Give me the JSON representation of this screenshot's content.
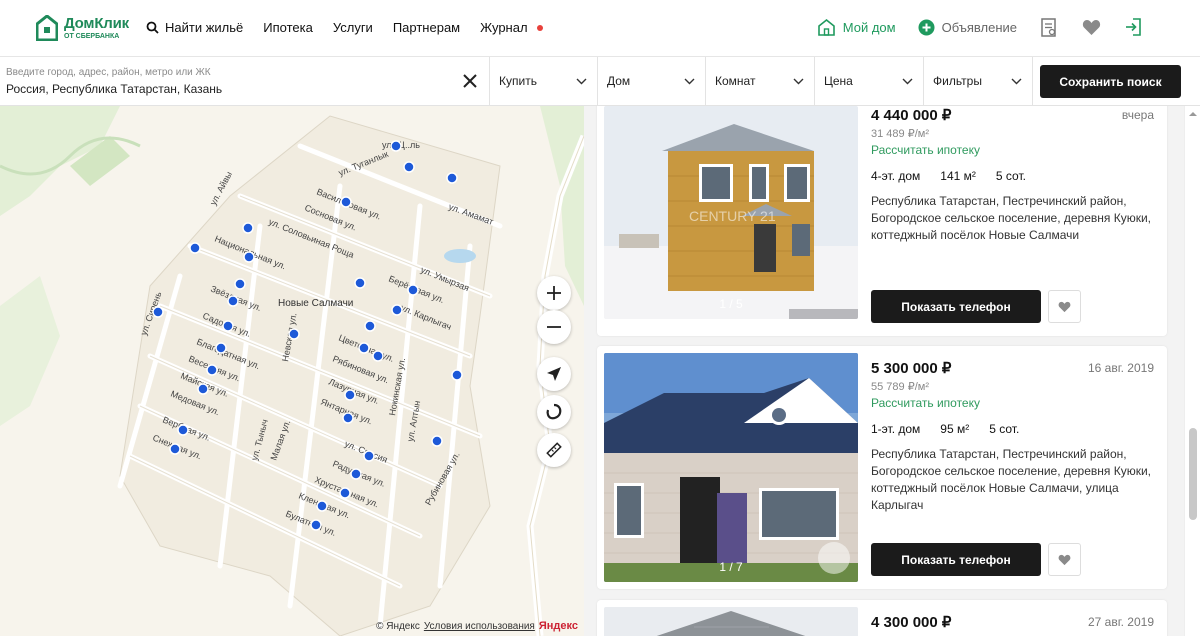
{
  "header": {
    "logo_name": "ДомКлик",
    "logo_sub": "ОТ СБЕРБАНКА",
    "nav": [
      {
        "label": "Найти жильё",
        "icon": "search-icon"
      },
      {
        "label": "Ипотека"
      },
      {
        "label": "Услуги"
      },
      {
        "label": "Партнерам"
      },
      {
        "label": "Журнал",
        "badge": "red-dot"
      }
    ],
    "my_home": "Мой дом",
    "announcement": "Объявление",
    "icons": [
      "document-icon",
      "heart-icon",
      "login-icon"
    ]
  },
  "filters": {
    "search_placeholder": "Введите город, адрес, район, метро или ЖК",
    "search_value": "Россия, Республика Татарстан, Казань",
    "deal": "Купить",
    "type": "Дом",
    "rooms": "Комнат",
    "price": "Цена",
    "more": "Фильтры",
    "save": "Сохранить поиск"
  },
  "map": {
    "village": "Новые Салмачи",
    "streets": [
      "ул. Щ..ль",
      "ул. Туганлык",
      "Васильковая ул.",
      "Сосновая ул.",
      "ул. Соловьиная Роща",
      "ул. Амамат",
      "ул. Айвы",
      "ул. Умырзая",
      "Национальная ул.",
      "Берёзовая ул.",
      "ул. Карлыгач",
      "Звёздная ул.",
      "Садовая ул.",
      "Благодатная ул.",
      "Весенняя ул.",
      "Майская ул.",
      "Медовая ул.",
      "Вербная ул.",
      "Снежная ул.",
      "ул. Сирень",
      "Невская ул.",
      "Цветочная ул.",
      "Рябиновая ул.",
      "Лазурная ул.",
      "Янтарная ул.",
      "Нокинская ул.",
      "ул. Алтын",
      "ул. Спасия",
      "Радужная ул.",
      "Хрустальная ул.",
      "Кленовая ул.",
      "Булатная ул.",
      "Рубиновая ул.",
      "Малая ул.",
      "ул. Тыныч"
    ],
    "copyright": "© Яндекс",
    "terms": "Условия использования",
    "brand": "Яндекс"
  },
  "listings": [
    {
      "price": "4 440 000 ₽",
      "price_per_m2": "31 489 ₽/м²",
      "mortgage": "Рассчитать ипотеку",
      "floors": "4-эт. дом",
      "area": "141 м²",
      "land": "5 сот.",
      "address": "Республика Татарстан, Пестречинский район, Богородское сельское поселение, деревня Куюки, коттеджный посёлок Новые Салмачи",
      "date": "вчера",
      "photos": "1 / 5",
      "watermark": "CENTURY 21",
      "phone_button": "Показать телефон"
    },
    {
      "price": "5 300 000 ₽",
      "price_per_m2": "55 789 ₽/м²",
      "mortgage": "Рассчитать ипотеку",
      "floors": "1-эт. дом",
      "area": "95 м²",
      "land": "5 сот.",
      "address": "Республика Татарстан, Пестречинский район, Богородское сельское поселение, деревня Куюки, коттеджный посёлок Новые Салмачи, улица Карлыгач",
      "date": "16 авг. 2019",
      "photos": "1 / 7",
      "phone_button": "Показать телефон"
    },
    {
      "price": "4 300 000 ₽",
      "date": "27 авг. 2019"
    }
  ],
  "colors": {
    "brand_green": "#1f8a5a",
    "accent_green": "#2f9a5e",
    "button_dark": "#1b1b1b",
    "map_pin": "#1d59d8"
  }
}
